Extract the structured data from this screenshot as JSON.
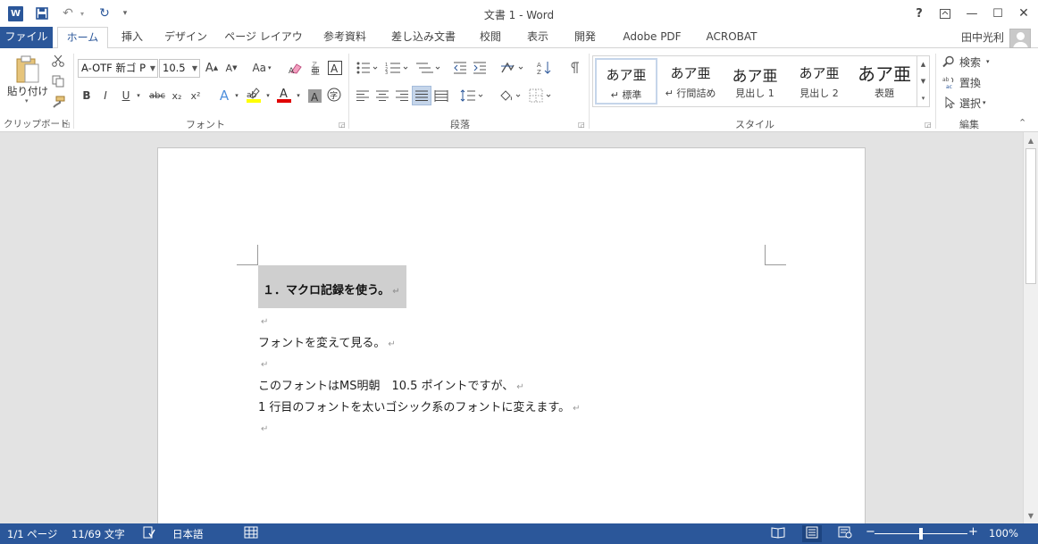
{
  "window": {
    "title": "文書 1 - Word",
    "help": "?",
    "ribbon_display": "⧉",
    "minimize": "—",
    "maximize": "☐",
    "close": "✕"
  },
  "qat": {
    "logo": "W",
    "save": "🖫",
    "undo": "↶",
    "redo": "↻",
    "customize": "▾"
  },
  "tabs": [
    {
      "label": "ファイル"
    },
    {
      "label": "ホーム"
    },
    {
      "label": "挿入"
    },
    {
      "label": "デザイン"
    },
    {
      "label": "ページ レイアウト"
    },
    {
      "label": "参考資料"
    },
    {
      "label": "差し込み文書"
    },
    {
      "label": "校閲"
    },
    {
      "label": "表示"
    },
    {
      "label": "開発"
    },
    {
      "label": "Adobe  PDF"
    },
    {
      "label": "ACROBAT"
    }
  ],
  "user": {
    "name": "田中光利"
  },
  "ribbon": {
    "clipboard": {
      "label": "クリップボード",
      "paste_label": "貼り付け"
    },
    "font": {
      "label": "フォント",
      "font_name": "A-OTF 新ゴ P",
      "font_size": "10.5",
      "grow": "A",
      "shrink": "A",
      "case": "Aa",
      "bold": "B",
      "italic": "I",
      "underline": "U",
      "strike": "abc",
      "subscript": "x₂",
      "superscript": "x²",
      "effects": "A",
      "font_color": "A",
      "shading": "A",
      "enclose": "字"
    },
    "paragraph": {
      "label": "段落"
    },
    "styles": {
      "label": "スタイル",
      "items": [
        {
          "preview": "あア亜",
          "name": "↵ 標準"
        },
        {
          "preview": "あア亜",
          "name": "↵ 行間詰め"
        },
        {
          "preview": "あア亜",
          "name": "見出し 1"
        },
        {
          "preview": "あア亜",
          "name": "見出し 2"
        },
        {
          "preview": "あア亜",
          "name": "表題"
        }
      ]
    },
    "editing": {
      "label": "編集",
      "find": "検索",
      "replace": "置換",
      "select": "選択"
    }
  },
  "document": {
    "heading": "１．マクロ記録を使う。",
    "paragraphs": [
      "",
      "フォントを変えて見る。",
      "",
      "このフォントはMS明朝　10.5 ポイントですが、",
      "1 行目のフォントを太いゴシック系のフォントに変えます。",
      ""
    ],
    "para_mark": "↵"
  },
  "status": {
    "page": "1/1 ページ",
    "words": "11/69 文字",
    "language": "日本語",
    "zoom": "100%",
    "zoom_minus": "−",
    "zoom_plus": "+"
  },
  "colors": {
    "accent": "#2b579a",
    "highlight": "#cfcfcf",
    "font_color_bar": "#e00000",
    "highlight_bar": "#ffff00"
  }
}
